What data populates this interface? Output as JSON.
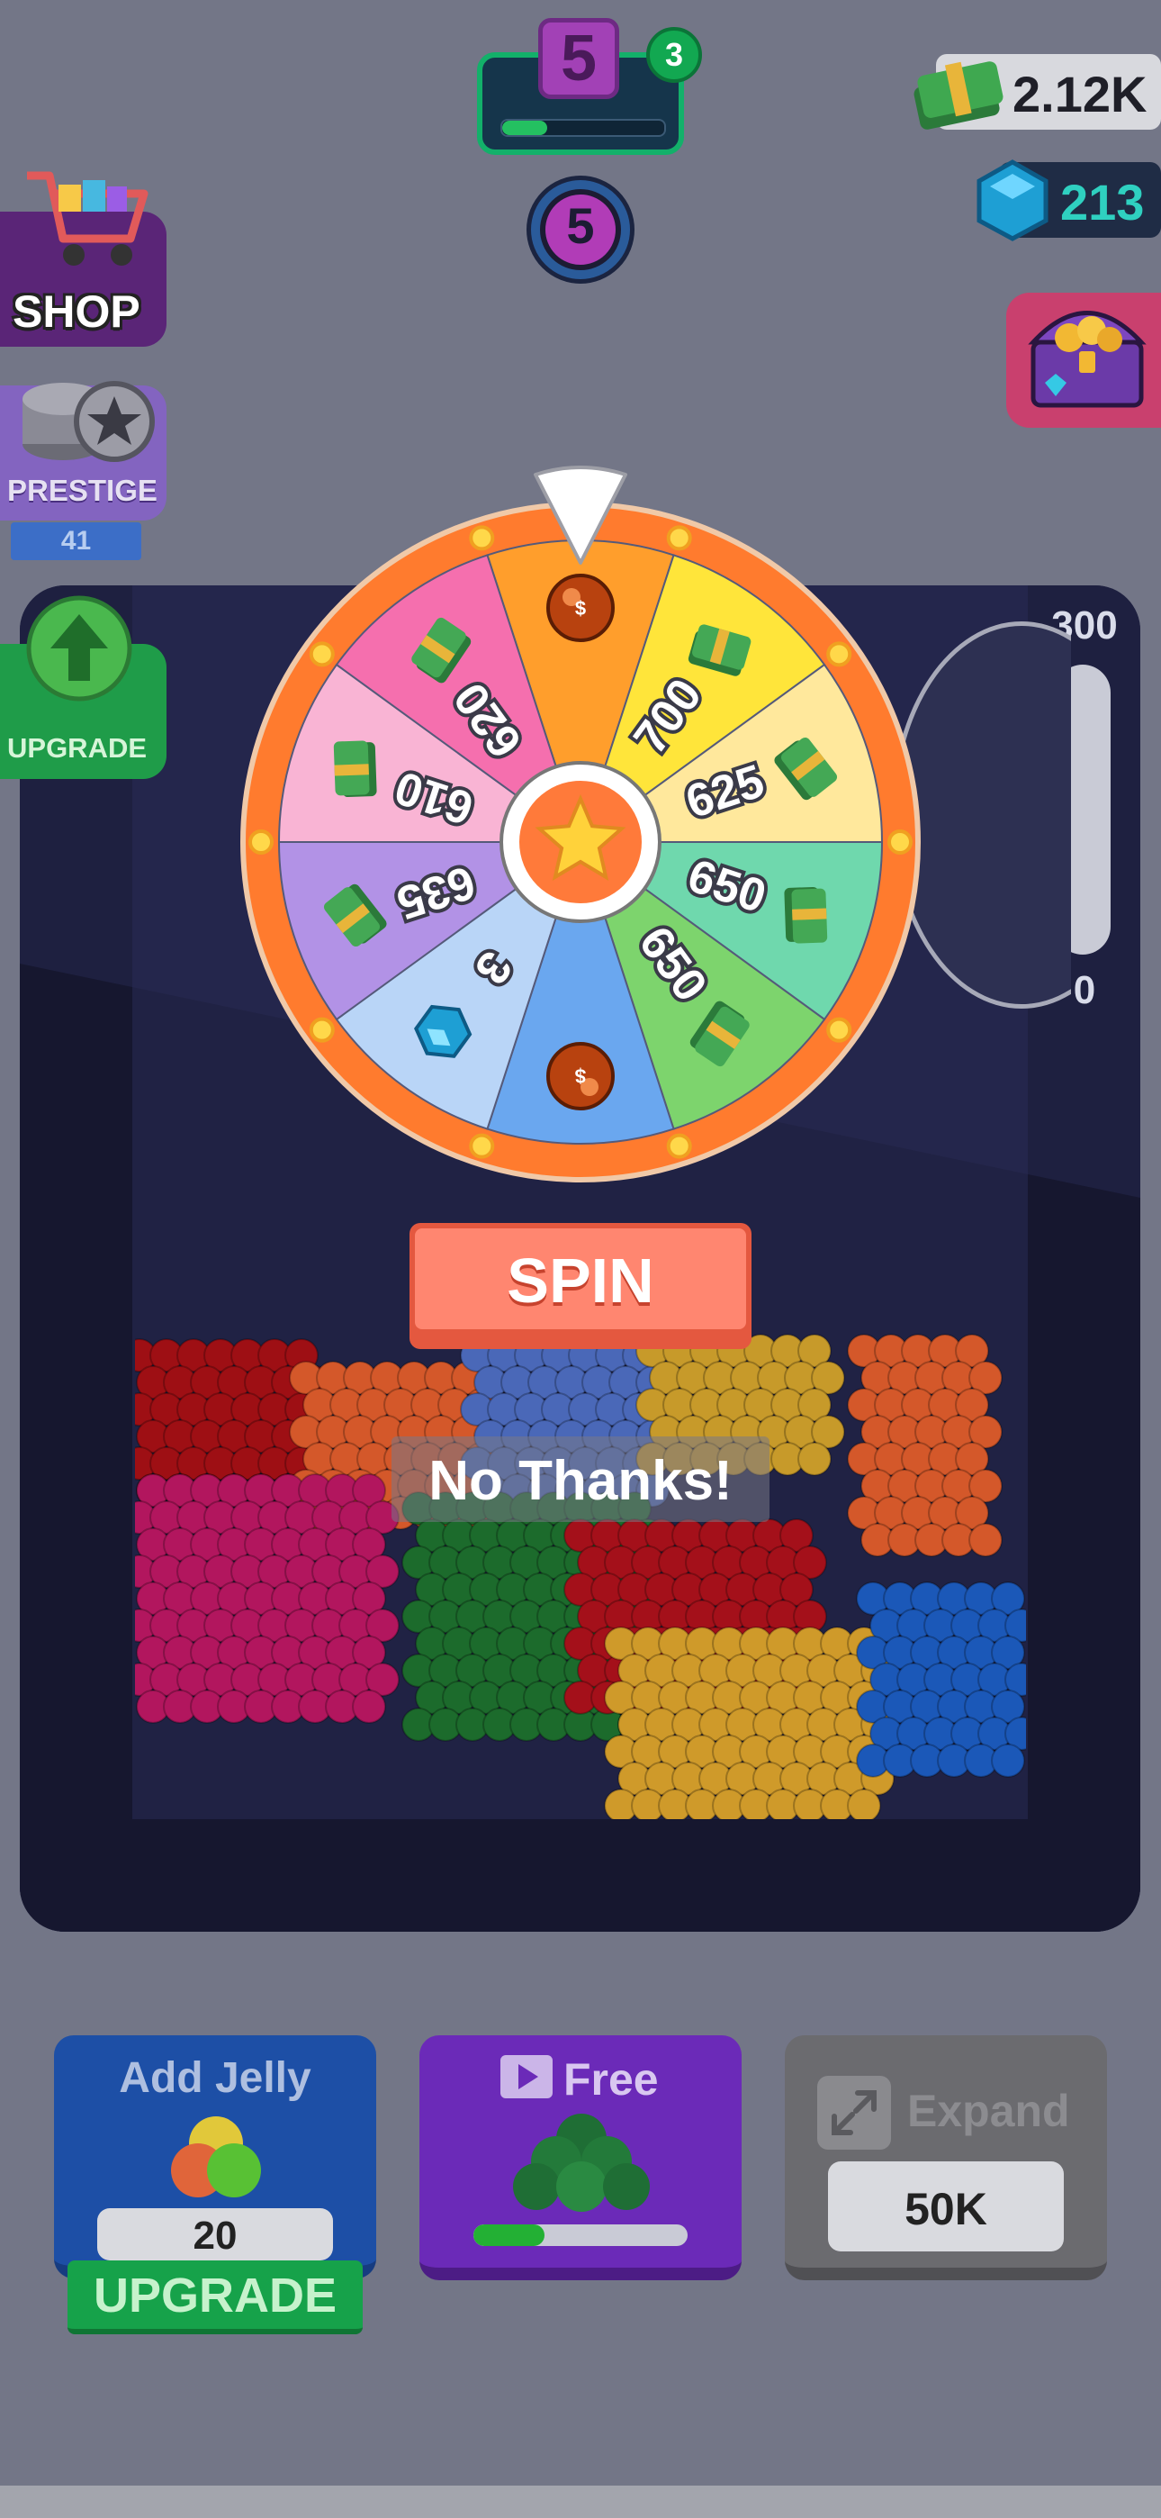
{
  "hud": {
    "level": "5",
    "level_badge": "3",
    "level_progress": 0.28,
    "secondary_level": "5",
    "cash": "2.12K",
    "gems": "213"
  },
  "sidebar": {
    "shop_label": "SHOP",
    "prestige_label": "PRESTIGE",
    "prestige_count": "41",
    "upgrade_label": "UPGRADE"
  },
  "meter": {
    "max": "300",
    "min": "0",
    "fill": 0
  },
  "wheel": {
    "segments": [
      {
        "label": "",
        "icon": "orb-icon",
        "color": "#ff9e2c"
      },
      {
        "label": "700",
        "icon": "cash-icon",
        "color": "#ffe53a"
      },
      {
        "label": "625",
        "icon": "cash-icon",
        "color": "#ffe89c"
      },
      {
        "label": "650",
        "icon": "cash-icon",
        "color": "#6fd8ad"
      },
      {
        "label": "650",
        "icon": "cash-icon",
        "color": "#7dd46d"
      },
      {
        "label": "",
        "icon": "orb-icon",
        "color": "#6aa7ef"
      },
      {
        "label": "3",
        "icon": "gem-icon",
        "color": "#b9d5f7"
      },
      {
        "label": "635",
        "icon": "cash-icon",
        "color": "#b292e6"
      },
      {
        "label": "610",
        "icon": "cash-icon",
        "color": "#f9b4d4"
      },
      {
        "label": "620",
        "icon": "cash-icon",
        "color": "#f56fae"
      }
    ],
    "rim_color": "#ff7b2e"
  },
  "actions": {
    "spin_label": "SPIN",
    "no_thanks_label": "No Thanks!"
  },
  "bottom": {
    "add_jelly_title": "Add Jelly",
    "add_jelly_value": "20",
    "add_jelly_upgrade": "UPGRADE",
    "free_title": "Free",
    "free_progress": 0.33,
    "expand_title": "Expand",
    "expand_price": "50K"
  }
}
